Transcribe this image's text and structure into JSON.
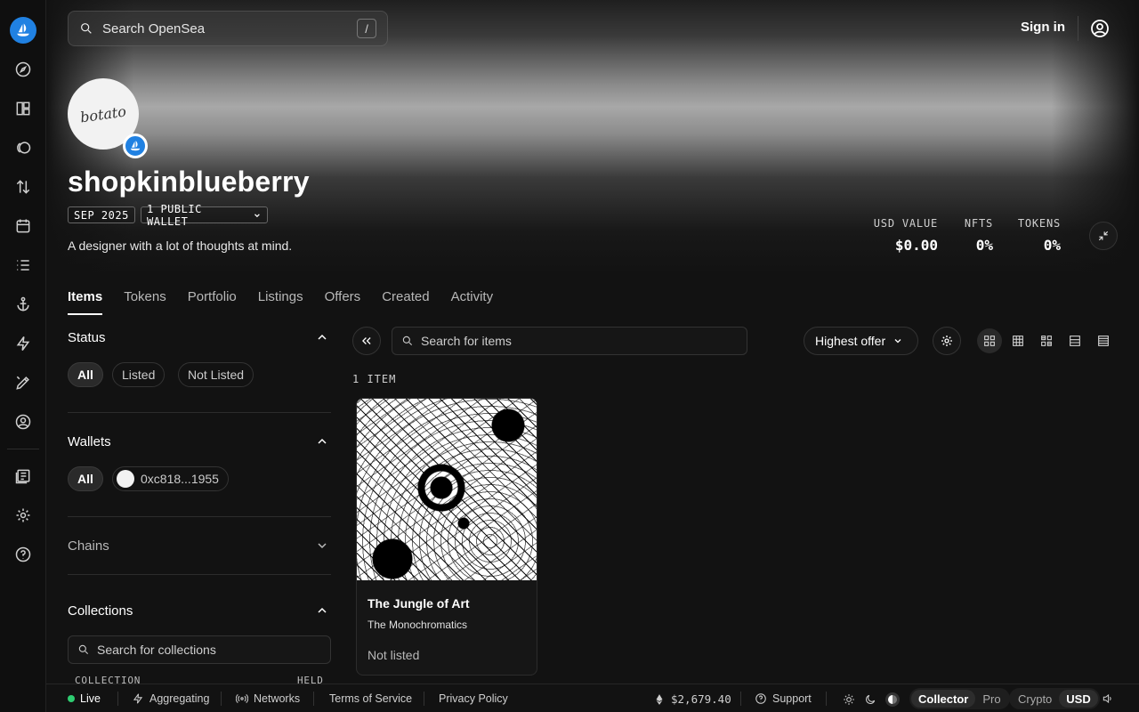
{
  "header": {
    "search_placeholder": "Search OpenSea",
    "search_shortcut": "/",
    "signin_label": "Sign in"
  },
  "profile": {
    "avatar_text": "botato",
    "name": "shopkinblueberry",
    "joined": "SEP 2025",
    "wallets_chip": "1 PUBLIC WALLET",
    "bio": "A designer with a lot of thoughts at mind.",
    "stats": [
      {
        "label": "USD VALUE",
        "value": "$0.00"
      },
      {
        "label": "NFTS",
        "value": "0%"
      },
      {
        "label": "TOKENS",
        "value": "0%"
      }
    ]
  },
  "tabs": [
    "Items",
    "Tokens",
    "Portfolio",
    "Listings",
    "Offers",
    "Created",
    "Activity"
  ],
  "filters": {
    "status": {
      "title": "Status",
      "options": [
        "All",
        "Listed",
        "Not Listed"
      ]
    },
    "wallets": {
      "title": "Wallets",
      "options": [
        "All",
        "0xc818...1955"
      ]
    },
    "chains": {
      "title": "Chains"
    },
    "collections": {
      "title": "Collections",
      "search_placeholder": "Search for collections",
      "col_collection": "COLLECTION",
      "col_held": "HELD"
    }
  },
  "main": {
    "search_placeholder": "Search for items",
    "sort_label": "Highest offer",
    "item_count": "1 ITEM",
    "items": [
      {
        "title": "The Jungle of Art",
        "collection": "The Monochromatics",
        "status": "Not listed"
      }
    ]
  },
  "footer": {
    "live": "Live",
    "aggregating": "Aggregating",
    "networks": "Networks",
    "terms": "Terms of Service",
    "privacy": "Privacy Policy",
    "eth_price": "$2,679.40",
    "support": "Support",
    "mode_collector": "Collector",
    "mode_pro": "Pro",
    "currency_crypto": "Crypto",
    "currency_usd": "USD"
  },
  "colors": {
    "accent": "#2081e2",
    "live": "#2ecc71",
    "background": "#121212"
  }
}
